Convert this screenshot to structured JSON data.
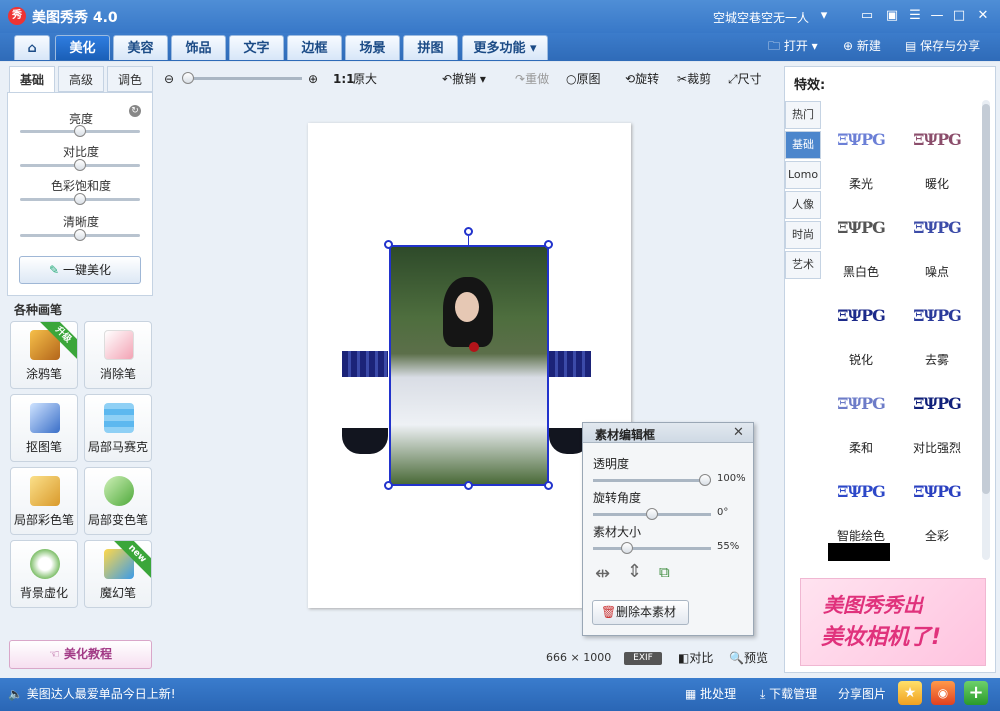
{
  "app": {
    "title": "美图秀秀 4.0",
    "logo": "秀",
    "user": "空城空巷空无一人",
    "accent": "#3a7ccd"
  },
  "nav": {
    "home": "⌂",
    "tabs": [
      "美化",
      "美容",
      "饰品",
      "文字",
      "边框",
      "场景",
      "拼图",
      "更多功能 ▾"
    ],
    "open": "打开",
    "new": "新建",
    "save": "保存与分享"
  },
  "left": {
    "subtabs": [
      "基础",
      "高级",
      "调色"
    ],
    "sliders": [
      {
        "label": "亮度",
        "value": 0.5
      },
      {
        "label": "对比度",
        "value": 0.5
      },
      {
        "label": "色彩饱和度",
        "value": 0.5
      },
      {
        "label": "清晰度",
        "value": 0.5
      }
    ],
    "onekey": "一键美化",
    "brushes_title": "各种画笔",
    "tools": [
      {
        "label": "涂鸦笔",
        "icon": "pen-icon",
        "badge": "升级"
      },
      {
        "label": "消除笔",
        "icon": "eraser-icon",
        "badge": ""
      },
      {
        "label": "抠图笔",
        "icon": "cutout-pen-icon",
        "badge": ""
      },
      {
        "label": "局部马赛克",
        "icon": "mosaic-icon",
        "badge": ""
      },
      {
        "label": "局部彩色笔",
        "icon": "color-brush-icon",
        "badge": ""
      },
      {
        "label": "局部变色笔",
        "icon": "recolor-brush-icon",
        "badge": ""
      },
      {
        "label": "背景虚化",
        "icon": "blur-icon",
        "badge": ""
      },
      {
        "label": "魔幻笔",
        "icon": "magic-pen-icon",
        "badge": "new"
      }
    ],
    "tutorial": "美化教程"
  },
  "toolbar": {
    "zoom_11": "1:1",
    "original_size": "原大",
    "undo": "撤销",
    "redo": "重做",
    "original": "原图",
    "rotate": "旋转",
    "crop": "裁剪",
    "size": "尺寸"
  },
  "material_box": {
    "title": "素材编辑框",
    "opacity_label": "透明度",
    "opacity_value": "100%",
    "opacity": 1.0,
    "rotate_label": "旋转角度",
    "rotate_value": "0°",
    "rotate": 0.5,
    "size_label": "素材大小",
    "size_value": "55%",
    "size": 0.3,
    "delete": "删除本素材"
  },
  "status": {
    "width": "666",
    "x": "×",
    "height": "1000",
    "exif": "EXIF",
    "compare": "对比",
    "preview": "预览"
  },
  "right": {
    "title": "特效:",
    "tabs": [
      "热门",
      "基础",
      "Lomo",
      "人像",
      "时尚",
      "艺术"
    ],
    "effects": [
      "柔光",
      "暖化",
      "黑白色",
      "噪点",
      "锐化",
      "去雾",
      "柔和",
      "对比强烈",
      "智能绘色",
      "全彩"
    ],
    "ad_line1": "美图秀秀出",
    "ad_line2": "美妆相机了!"
  },
  "bottom": {
    "news": "美图达人最爱单品今日上新!",
    "batch": "批处理",
    "download": "下载管理",
    "share": "分享图片"
  }
}
